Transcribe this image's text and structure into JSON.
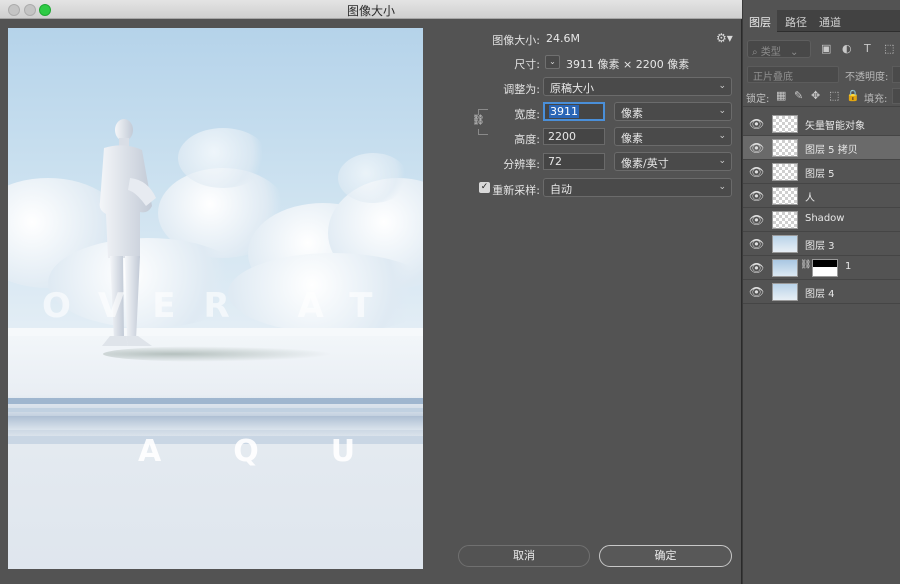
{
  "window": {
    "title": "图像大小"
  },
  "form": {
    "image_size_label": "图像大小:",
    "image_size_value": "24.6M",
    "dimensions_label": "尺寸:",
    "dimensions_value": "3911 像素  ×  2200 像素",
    "fit_to_label": "调整为:",
    "fit_to_value": "原稿大小",
    "width_label": "宽度:",
    "width_value": "3911",
    "width_unit": "像素",
    "height_label": "高度:",
    "height_value": "2200",
    "height_unit": "像素",
    "resolution_label": "分辨率:",
    "resolution_value": "72",
    "resolution_unit": "像素/英寸",
    "resample_label": "重新采样:",
    "resample_checked": true,
    "resample_value": "自动"
  },
  "buttons": {
    "cancel": "取消",
    "ok": "确定"
  },
  "preview": {
    "line1": "OVER AT T",
    "line2": "AQU"
  },
  "layers_panel": {
    "tabs": [
      "图层",
      "路径",
      "通道"
    ],
    "filter_placeholder": "类型",
    "blend_mode": "正片叠底",
    "opacity_label": "不透明度:",
    "lock_label": "锁定:",
    "fill_label": "填充:",
    "layers": [
      {
        "name": "矢量智能对象",
        "thumb": "checker",
        "selected": false
      },
      {
        "name": "图层 5 拷贝",
        "thumb": "checker",
        "selected": true
      },
      {
        "name": "图层 5",
        "thumb": "checker",
        "selected": false
      },
      {
        "name": "人",
        "thumb": "checker",
        "selected": false
      },
      {
        "name": "Shadow",
        "thumb": "checker",
        "selected": false
      },
      {
        "name": "图层 3",
        "thumb": "sky",
        "selected": false
      },
      {
        "name": "1",
        "thumb": "cloudy",
        "selected": false
      },
      {
        "name": "图层 4",
        "thumb": "sky",
        "selected": false
      }
    ]
  }
}
